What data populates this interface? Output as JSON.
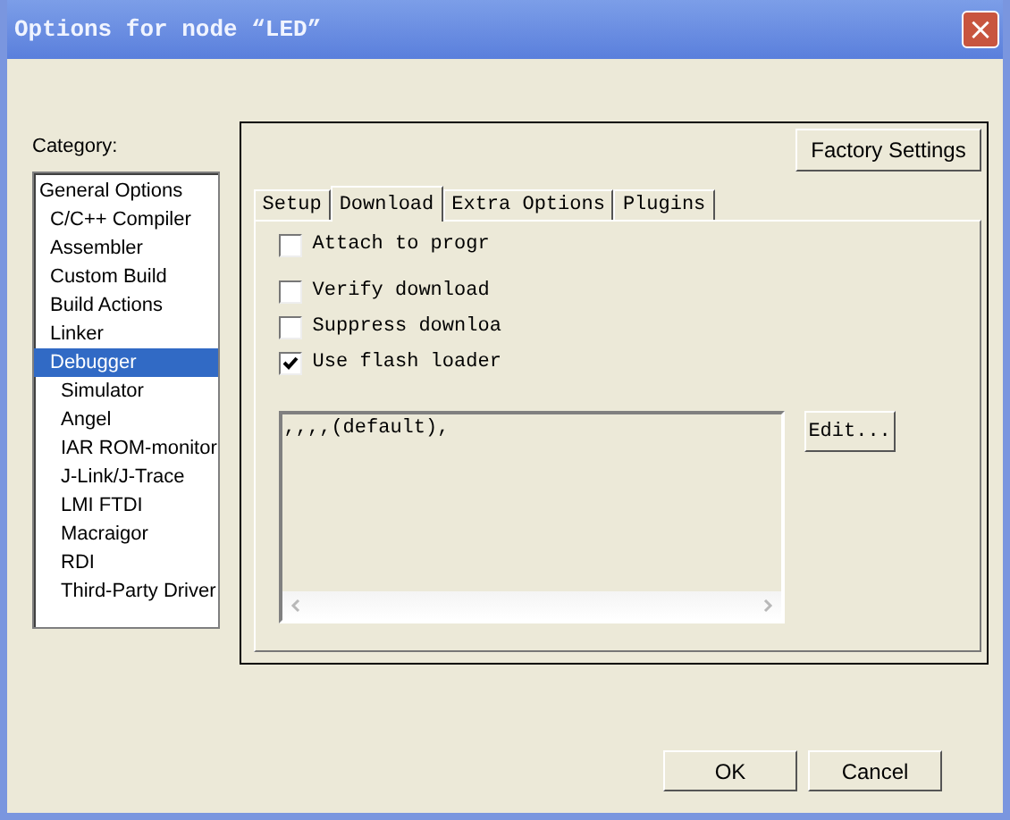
{
  "window": {
    "title": "Options for node “LED”",
    "close": "×"
  },
  "category": {
    "label": "Category:",
    "items": [
      {
        "label": "General Options",
        "selected": false
      },
      {
        "label": "C/C++ Compiler",
        "selected": false
      },
      {
        "label": "Assembler",
        "selected": false
      },
      {
        "label": "Custom Build",
        "selected": false
      },
      {
        "label": "Build Actions",
        "selected": false
      },
      {
        "label": "Linker",
        "selected": false
      },
      {
        "label": "Debugger",
        "selected": true,
        "children": [
          {
            "label": "Simulator",
            "selected": false
          },
          {
            "label": "Angel",
            "selected": false
          },
          {
            "label": "IAR ROM-monitor",
            "selected": false
          },
          {
            "label": "J-Link/J-Trace",
            "selected": false
          },
          {
            "label": "LMI FTDI",
            "selected": false
          },
          {
            "label": "Macraigor",
            "selected": false
          },
          {
            "label": "RDI",
            "selected": false
          },
          {
            "label": "Third-Party Driver",
            "selected": false
          }
        ]
      }
    ]
  },
  "factory_button": "Factory Settings",
  "tabs": [
    {
      "label": "Setup",
      "selected": false
    },
    {
      "label": "Download",
      "selected": true
    },
    {
      "label": "Extra Options",
      "selected": false
    },
    {
      "label": "Plugins",
      "selected": false
    }
  ],
  "checkboxes": [
    {
      "label": "Attach to progr",
      "checked": false
    },
    {
      "label": "Verify download",
      "checked": false
    },
    {
      "label": "Suppress downloa",
      "checked": false
    },
    {
      "label": "Use flash loader",
      "checked": true
    }
  ],
  "loader_list": {
    "lines": [
      ",,,,(default),"
    ]
  },
  "edit_button": "Edit...",
  "buttons": [
    "OK",
    "Cancel"
  ]
}
